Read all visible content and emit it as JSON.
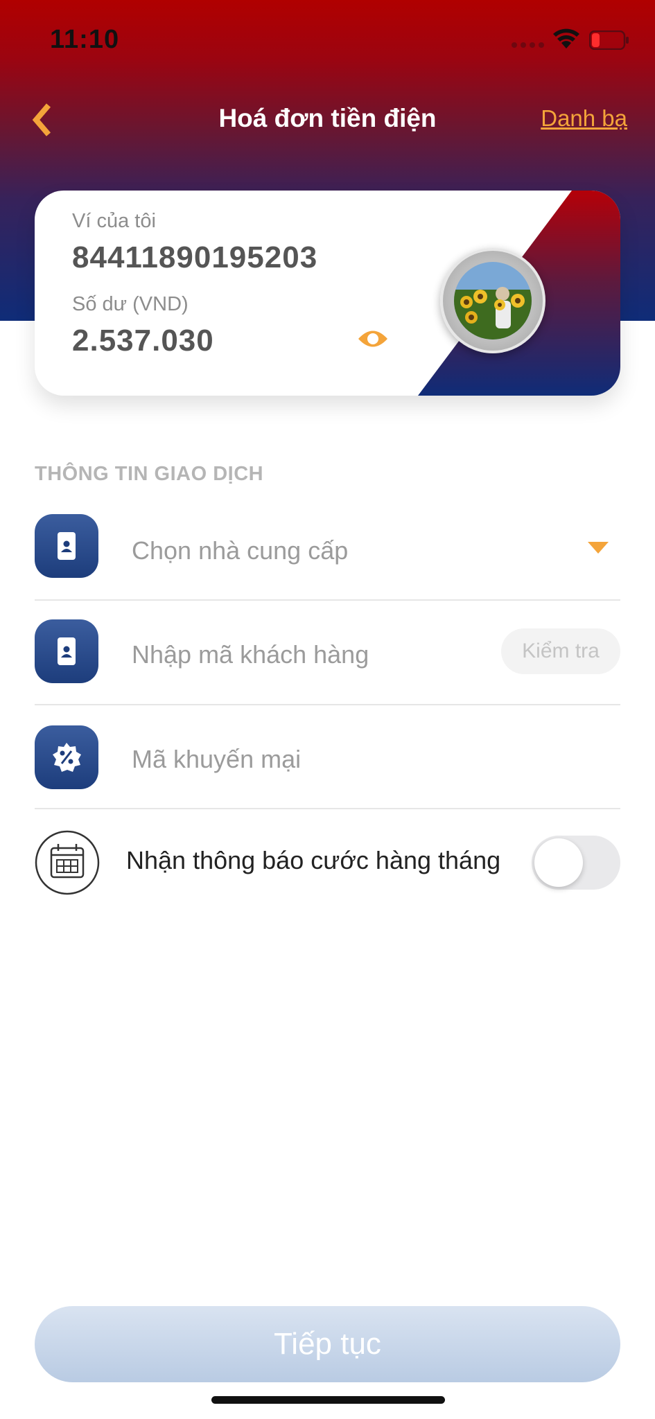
{
  "status_bar": {
    "time": "11:10"
  },
  "header": {
    "title": "Hoá đơn tiền điện",
    "contacts_link": "Danh bạ"
  },
  "wallet": {
    "label": "Ví của tôi",
    "number": "84411890195203",
    "balance_label": "Số dư (VND)",
    "balance": "2.537.030"
  },
  "form": {
    "section_title": "THÔNG TIN GIAO DỊCH",
    "provider_placeholder": "Chọn nhà cung cấp",
    "customer_placeholder": "Nhập mã khách hàng",
    "check_button": "Kiểm tra",
    "promo_placeholder": "Mã khuyến mại",
    "notify_label": "Nhận thông báo cước hàng tháng",
    "notify_enabled": false
  },
  "footer": {
    "continue_button": "Tiếp tục"
  },
  "colors": {
    "header_top": "#b00000",
    "header_bottom": "#0f2c78",
    "accent_orange": "#f4a43a",
    "icon_blue": "#1d3d7c"
  },
  "icons": [
    "chevron-left-icon",
    "wifi-icon",
    "battery-icon",
    "eye-icon",
    "phone-contact-icon",
    "discount-badge-icon",
    "calendar-icon",
    "caret-down-icon"
  ]
}
